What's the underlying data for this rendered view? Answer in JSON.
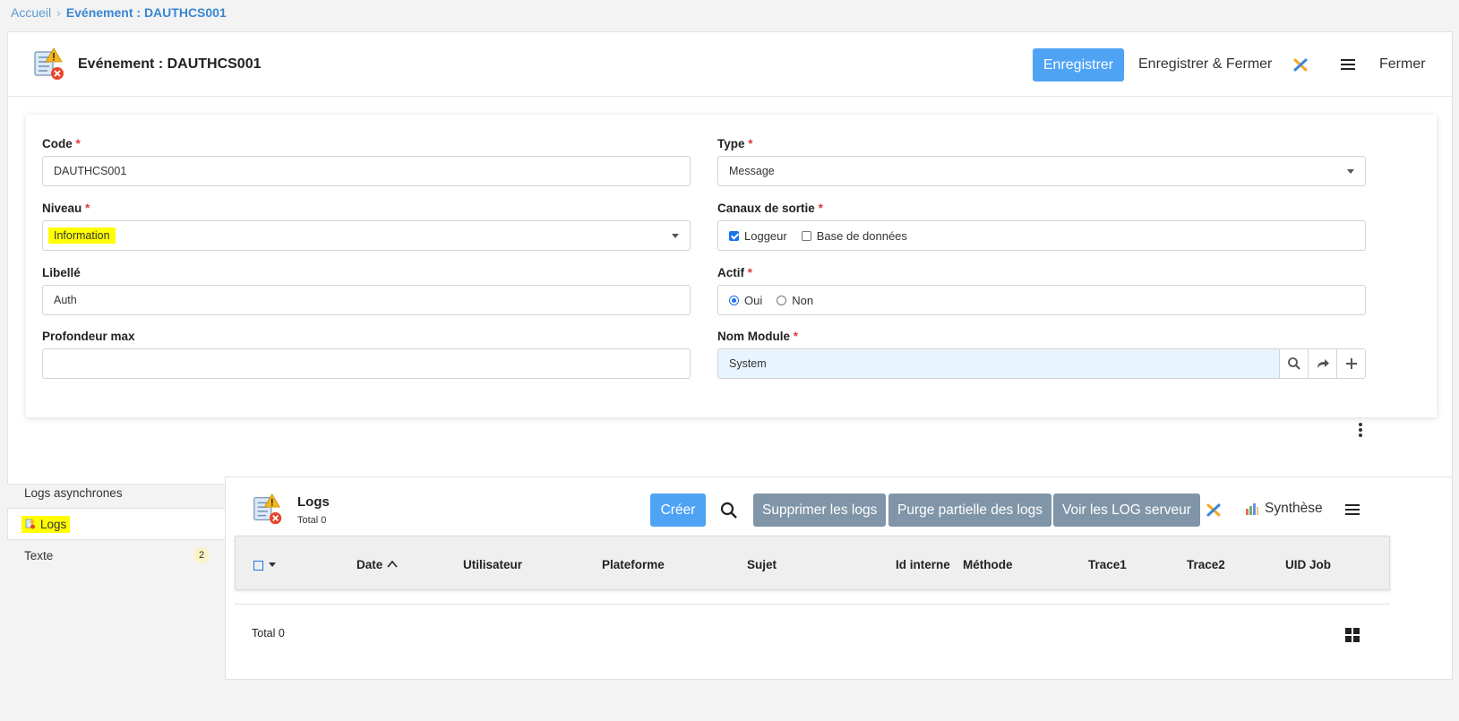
{
  "breadcrumb": {
    "home": "Accueil",
    "separator": ">",
    "current": "Evénement : DAUTHCS001"
  },
  "header": {
    "title": "Evénement : DAUTHCS001",
    "save_label": "Enregistrer",
    "save_close_label": "Enregistrer & Fermer",
    "close_label": "Fermer"
  },
  "form": {
    "code": {
      "label": "Code",
      "required": "*",
      "value": "DAUTHCS001"
    },
    "type": {
      "label": "Type",
      "required": "*",
      "value": "Message"
    },
    "niveau": {
      "label": "Niveau",
      "required": "*",
      "value": "Information"
    },
    "canaux": {
      "label": "Canaux de sortie",
      "required": "*",
      "options": [
        {
          "label": "Loggeur",
          "checked": true
        },
        {
          "label": "Base de données",
          "checked": false
        }
      ]
    },
    "libelle": {
      "label": "Libellé",
      "value": "Auth"
    },
    "actif": {
      "label": "Actif",
      "required": "*",
      "options": [
        {
          "label": "Oui",
          "selected": true
        },
        {
          "label": "Non",
          "selected": false
        }
      ]
    },
    "profondeur": {
      "label": "Profondeur max",
      "value": ""
    },
    "module": {
      "label": "Nom Module",
      "required": "*",
      "value": "System"
    }
  },
  "tabs": [
    {
      "label": "Logs asynchrones"
    },
    {
      "label": "Logs"
    },
    {
      "label": "Texte",
      "badge": "2"
    }
  ],
  "logs": {
    "title": "Logs",
    "total": "Total 0",
    "create_label": "Créer",
    "delete_logs_label": "Supprimer les logs",
    "purge_label": "Purge partielle des logs",
    "server_log_label": "Voir les LOG serveur",
    "synthese_label": "Synthèse",
    "columns": [
      "Date",
      "Utilisateur",
      "Plateforme",
      "Sujet",
      "Id interne",
      "Méthode",
      "Trace1",
      "Trace2",
      "UID Job"
    ],
    "footer_total": "Total 0"
  },
  "colors": {
    "accent": "#4ea3f5",
    "grey_button": "#8095a8",
    "highlight": "#ffff00",
    "required": "#e03c3c"
  }
}
